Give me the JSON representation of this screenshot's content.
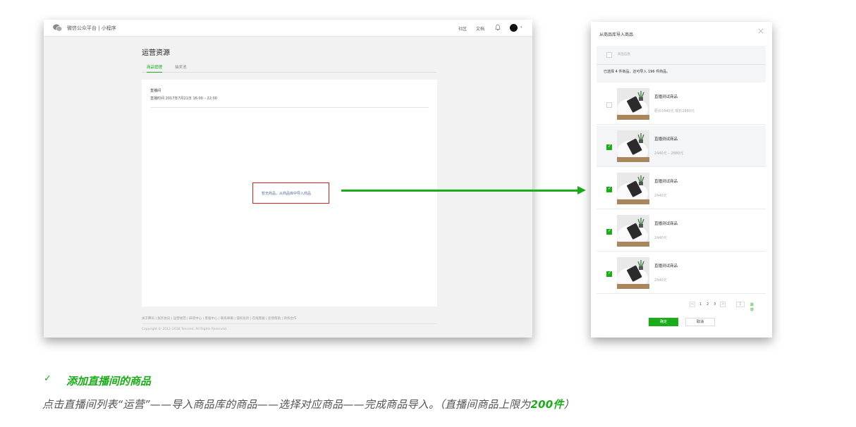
{
  "left_screenshot": {
    "header": {
      "platform_title": "微信公众平台 | 小程序",
      "links": [
        "社区",
        "文档"
      ]
    },
    "page_title": "运营资源",
    "tabs": [
      {
        "label": "商品管理",
        "active": true
      },
      {
        "label": "抽奖池",
        "active": false
      }
    ],
    "live": {
      "title": "直播间",
      "time": "直播时间 2017年7月21日 16:00 – 22:00"
    },
    "empty_prompt": "暂无商品，从商品库中导入商品",
    "footer": {
      "links": "关于腾讯 | 服务协议 | 运营规范 | 辟谣中心 | 客服中心 | 联系邮箱 | 侵权投诉 | 在线客服 | 反馈帮助 | 商务合作",
      "copyright": "Copyright © 2012–2018 Tencent. All Rights Reserved."
    }
  },
  "dialog": {
    "title": "从商品库导入商品",
    "header_label": "商品信息",
    "selected_info": "已选择 4 件商品，还可导入 196 件商品。",
    "products": [
      {
        "name": "直播测试商品",
        "price": "原价2440元   现价2880元",
        "checked": false
      },
      {
        "name": "直播测试商品",
        "price": "2440元 – 2880元",
        "checked": true
      },
      {
        "name": "直播测试商品",
        "price": "2440元",
        "checked": true
      },
      {
        "name": "直播测试商品",
        "price": "2440元",
        "checked": true
      },
      {
        "name": "直播测试商品",
        "price": "2440元",
        "checked": true
      }
    ],
    "pager": {
      "prev": "<",
      "pages": [
        "1",
        "2",
        "3"
      ],
      "next": ">",
      "jump_input": "1",
      "jump_label": "跳转"
    },
    "ok_label": "确定",
    "cancel_label": "取消"
  },
  "caption": {
    "check": "✓",
    "title": "添加直播间的商品",
    "desc": "点击直播间列表“运营”——导入商品库的商品——选择对应商品——完成商品导入。（直播间商品上限为",
    "limit": "200件",
    "desc_end": "）"
  },
  "colors": {
    "accent": "#1aad19",
    "highlight_border": "#e02020"
  }
}
